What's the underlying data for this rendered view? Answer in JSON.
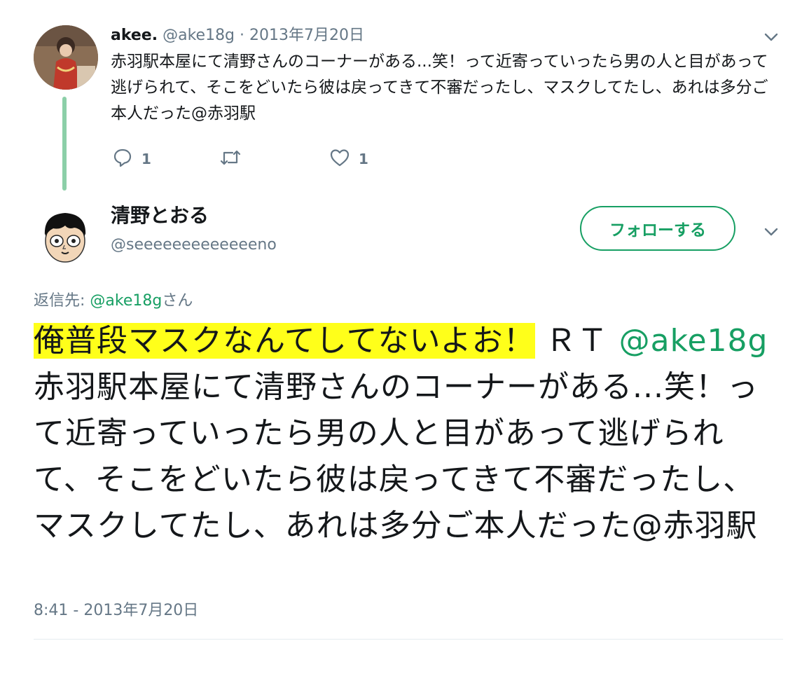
{
  "parent_tweet": {
    "display_name": "akee.",
    "handle": "@ake18g",
    "separator": "·",
    "date": "2013年7月20日",
    "text": "赤羽駅本屋にて清野さんのコーナーがある...笑！って近寄っていったら男の人と目があって逃げられて、そこをどいたら彼は戻ってきて不審だったし、マスクしてたし、あれは多分ご本人だった@赤羽駅",
    "reply_count": "1",
    "like_count": "1"
  },
  "main_tweet": {
    "display_name": "清野とおる",
    "handle": "@seeeeeeeeeeeeeno",
    "follow_label": "フォローする",
    "reply_to_prefix": "返信先: ",
    "reply_to_handle": "@ake18g",
    "reply_to_suffix": "さん",
    "highlighted_text": "俺普段マスクなんてしてないよお！",
    "rt_label": "ＲＴ",
    "mention": "@ake18g",
    "quoted_text": "赤羽駅本屋にて清野さんのコーナーがある...笑！って近寄っていったら男の人と目があって逃げられて、そこをどいたら彼は戻ってきて不審だったし、マスクしてたし、あれは多分ご本人だった@赤羽駅",
    "timestamp": "8:41 - 2013年7月20日"
  },
  "colors": {
    "accent": "#179f63",
    "thread_line": "#8ccfa8",
    "highlight": "#ffff1a",
    "meta": "#657786"
  },
  "icons": [
    "chevron-down-icon",
    "reply-icon",
    "retweet-icon",
    "heart-icon"
  ]
}
